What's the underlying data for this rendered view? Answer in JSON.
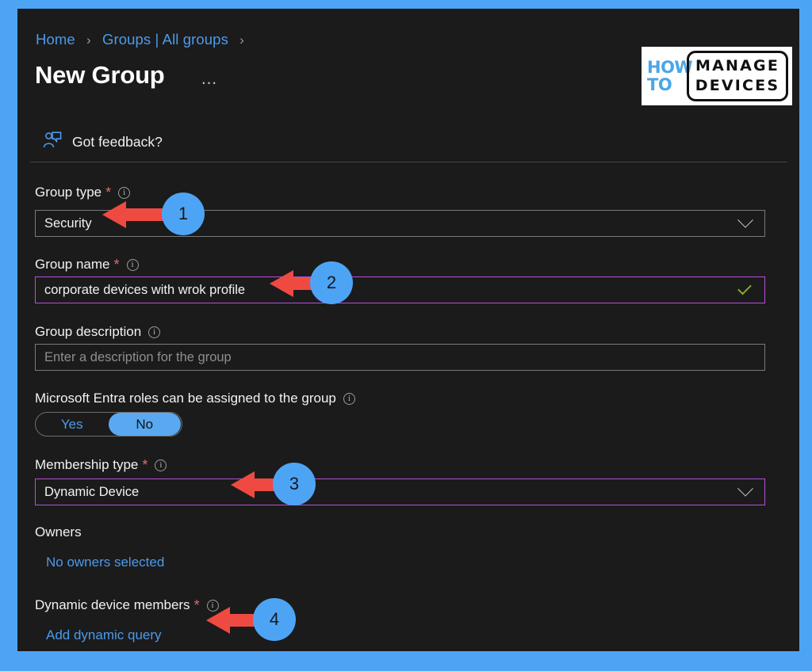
{
  "breadcrumb": {
    "items": [
      "Home",
      "Groups | All groups"
    ],
    "separator": "›"
  },
  "header": {
    "title": "New Group",
    "ellipsis": "…"
  },
  "logo": {
    "how": "HOW",
    "to": "TO",
    "manage": "MANAGE",
    "devices": "DEVICES"
  },
  "toolbar": {
    "feedback_label": "Got feedback?",
    "feedback_icon": "person-feedback-icon"
  },
  "form": {
    "group_type": {
      "label": "Group type",
      "required": "*",
      "value": "Security",
      "icon": "chevron-down-icon"
    },
    "group_name": {
      "label": "Group name",
      "required": "*",
      "value": "corporate devices with wrok profile",
      "icon": "check-icon"
    },
    "group_description": {
      "label": "Group description",
      "placeholder": "Enter a description for the group",
      "value": ""
    },
    "entra_roles": {
      "label": "Microsoft Entra roles can be assigned to the group",
      "options": [
        "Yes",
        "No"
      ],
      "selected": "No"
    },
    "membership_type": {
      "label": "Membership type",
      "required": "*",
      "value": "Dynamic Device",
      "icon": "chevron-down-icon"
    },
    "owners": {
      "label": "Owners",
      "link": "No owners selected"
    },
    "dynamic_device_members": {
      "label": "Dynamic device members",
      "required": "*",
      "link": "Add dynamic query"
    }
  },
  "annotations": [
    {
      "number": "1",
      "target": "group-type-field"
    },
    {
      "number": "2",
      "target": "group-name-field"
    },
    {
      "number": "3",
      "target": "membership-type-field"
    },
    {
      "number": "4",
      "target": "add-dynamic-query-link"
    }
  ],
  "colors": {
    "frame": "#4da4f5",
    "panel": "#1b1b1b",
    "link": "#4c9aeb",
    "focus_border": "#b650d8",
    "required": "#e06c6c",
    "valid_check": "#84a82c",
    "arrow": "#ef4a41"
  }
}
